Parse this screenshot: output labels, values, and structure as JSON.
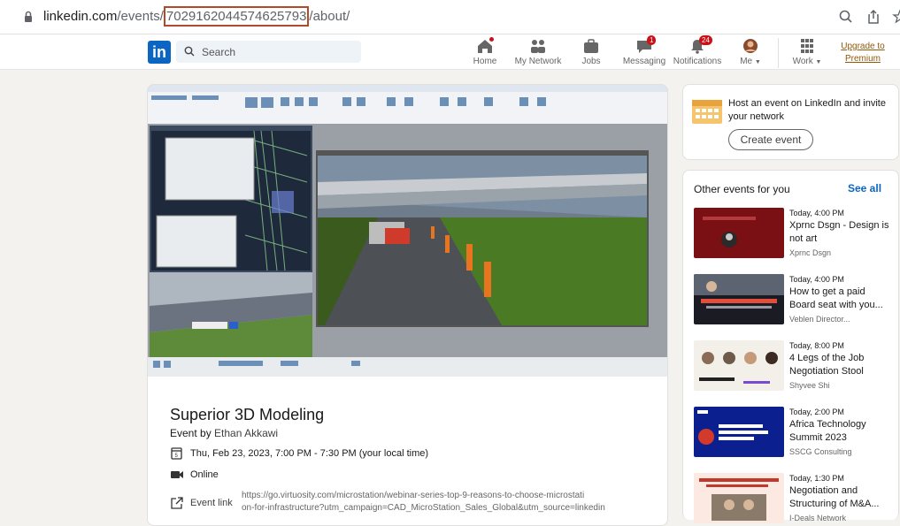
{
  "browser": {
    "url_prefix": "linkedin.com",
    "url_path_start": "/events/",
    "url_highlight": "7029162044574625793",
    "url_path_end": "/about/"
  },
  "nav": {
    "search_placeholder": "Search",
    "items": [
      {
        "label": "Home",
        "icon": "home-icon",
        "badge": ""
      },
      {
        "label": "My Network",
        "icon": "network-icon",
        "badge": ""
      },
      {
        "label": "Jobs",
        "icon": "briefcase-icon",
        "badge": ""
      },
      {
        "label": "Messaging",
        "icon": "messaging-icon",
        "badge": "1"
      },
      {
        "label": "Notifications",
        "icon": "bell-icon",
        "badge": "24"
      },
      {
        "label": "Me",
        "icon": "avatar-icon",
        "badge": ""
      },
      {
        "label": "Work",
        "icon": "grid-icon",
        "badge": ""
      }
    ],
    "upgrade_line1": "Upgrade to",
    "upgrade_line2": "Premium",
    "accent": "#0a66c2",
    "badge_color": "#cc1016"
  },
  "event": {
    "title": "Superior 3D Modeling",
    "by_prefix": "Event by",
    "organizer": "Ethan Akkawi",
    "datetime": "Thu, Feb 23, 2023, 7:00 PM - 7:30 PM (your local time)",
    "format": "Online",
    "link_label": "Event link",
    "link_line1": "https://go.virtuosity.com/microstation/webinar-series-top-9-reasons-to-choose-microstati",
    "link_line2": "on-for-infrastructure?utm_campaign=CAD_MicroStation_Sales_Global&utm_source=linkedin"
  },
  "sidebar": {
    "host_text": "Host an event on LinkedIn and invite your network",
    "create_label": "Create event",
    "other_heading": "Other events for you",
    "see_all": "See all",
    "events": [
      {
        "time": "Today, 4:00 PM",
        "name": "Xprnc Dsgn - Design is not art",
        "org": "Xprnc Dsgn",
        "thumb_color": "#7a0f14"
      },
      {
        "time": "Today, 4:00 PM",
        "name": "How to get a paid Board seat with you...",
        "org": "Veblen Director...",
        "thumb_color": "#1b1b24"
      },
      {
        "time": "Today, 8:00 PM",
        "name": "4 Legs of the Job Negotiation Stool",
        "org": "Shyvee Shi",
        "thumb_color": "#f3f0ea"
      },
      {
        "time": "Today, 2:00 PM",
        "name": "Africa Technology Summit 2023",
        "org": "SSCG Consulting",
        "thumb_color": "#0b1f8f"
      },
      {
        "time": "Today, 1:30 PM",
        "name": "Negotiation and Structuring of M&A...",
        "org": "I-Deals Network",
        "thumb_color": "#fbe9e2"
      }
    ]
  }
}
